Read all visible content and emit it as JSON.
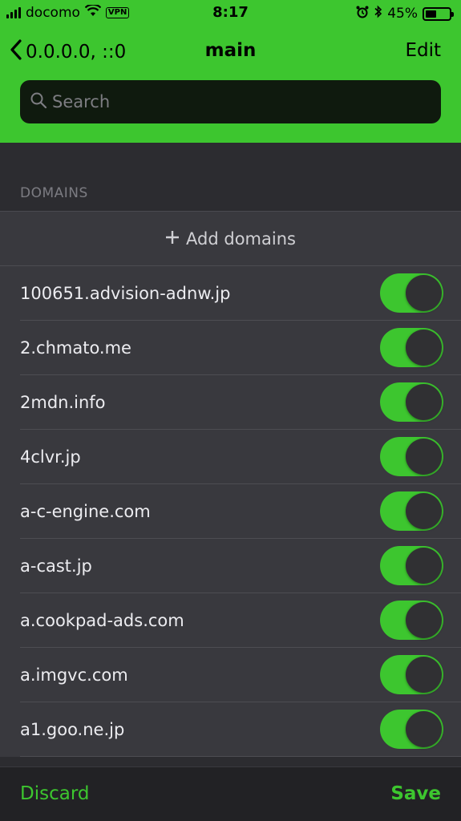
{
  "status_bar": {
    "carrier": "docomo",
    "vpn": "VPN",
    "time": "8:17",
    "battery_percent": "45%",
    "battery_level": 0.45
  },
  "nav": {
    "back_label": "0.0.0.0, ::0",
    "title": "main",
    "edit_label": "Edit"
  },
  "search": {
    "placeholder": "Search",
    "value": ""
  },
  "section": {
    "header": "DOMAINS",
    "add_label": "Add domains"
  },
  "domains": [
    {
      "name": "100651.advision-adnw.jp",
      "enabled": true
    },
    {
      "name": "2.chmato.me",
      "enabled": true
    },
    {
      "name": "2mdn.info",
      "enabled": true
    },
    {
      "name": "4clvr.jp",
      "enabled": true
    },
    {
      "name": "a-c-engine.com",
      "enabled": true
    },
    {
      "name": "a-cast.jp",
      "enabled": true
    },
    {
      "name": "a.cookpad-ads.com",
      "enabled": true
    },
    {
      "name": "a.imgvc.com",
      "enabled": true
    },
    {
      "name": "a1.goo.ne.jp",
      "enabled": true
    }
  ],
  "toolbar": {
    "discard_label": "Discard",
    "save_label": "Save"
  },
  "colors": {
    "accent": "#3dc62f",
    "background": "#2c2c30",
    "cell": "#39393e"
  }
}
